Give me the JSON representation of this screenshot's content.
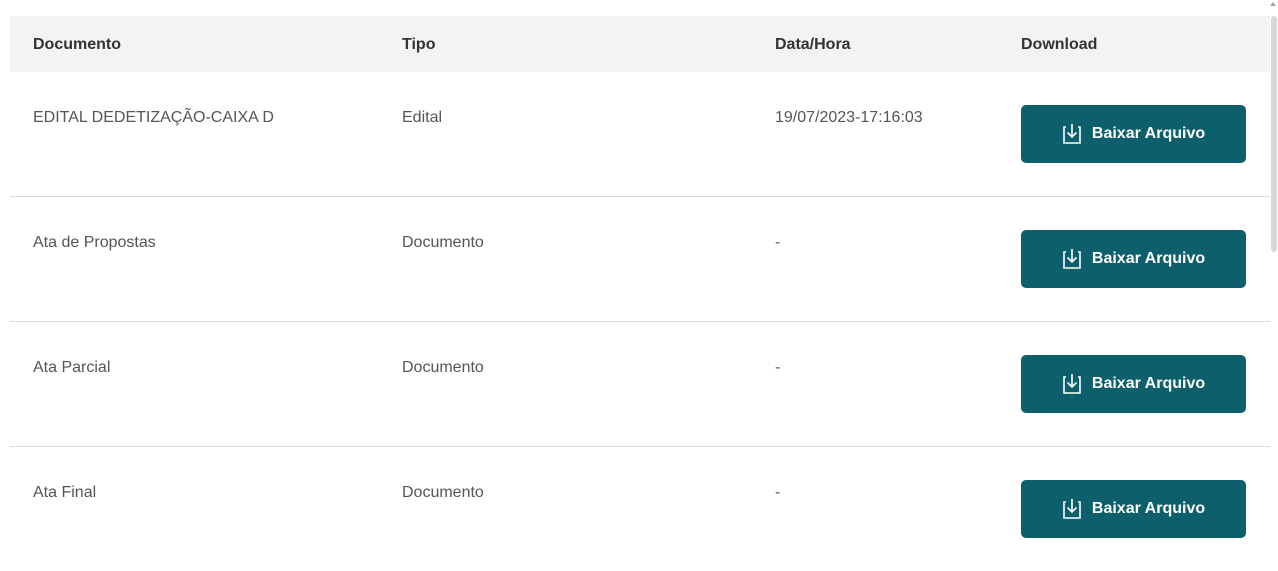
{
  "table": {
    "headers": {
      "documento": "Documento",
      "tipo": "Tipo",
      "data_hora": "Data/Hora",
      "download": "Download"
    },
    "rows": [
      {
        "documento": "EDITAL DEDETIZAÇÃO-CAIXA D",
        "tipo": "Edital",
        "data_hora": "19/07/2023-17:16:03",
        "button_label": "Baixar Arquivo"
      },
      {
        "documento": "Ata de Propostas",
        "tipo": "Documento",
        "data_hora": "-",
        "button_label": "Baixar Arquivo"
      },
      {
        "documento": "Ata Parcial",
        "tipo": "Documento",
        "data_hora": "-",
        "button_label": "Baixar Arquivo"
      },
      {
        "documento": "Ata Final",
        "tipo": "Documento",
        "data_hora": "-",
        "button_label": "Baixar Arquivo"
      }
    ]
  },
  "icons": {
    "download": "download-icon"
  },
  "colors": {
    "button_bg": "#0d5f6b",
    "header_bg": "#f3f3f3",
    "divider": "#d9d9d9"
  }
}
